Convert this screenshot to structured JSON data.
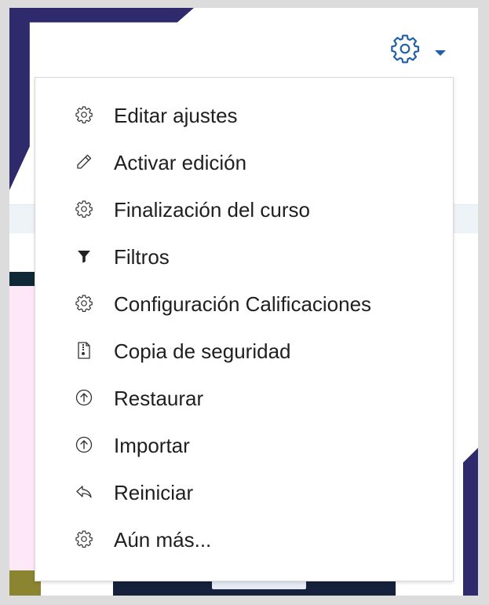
{
  "colors": {
    "accent": "#1f5fae",
    "brand_dark": "#2e2a6b",
    "text": "#1f1f1f"
  },
  "header": {
    "settings_menu_icon": "gear-icon",
    "settings_menu_caret": "caret-down-icon"
  },
  "menu": {
    "items": [
      {
        "label": "Editar ajustes",
        "icon": "gear-icon"
      },
      {
        "label": "Activar edición",
        "icon": "pencil-icon"
      },
      {
        "label": "Finalización del curso",
        "icon": "gear-icon"
      },
      {
        "label": "Filtros",
        "icon": "filter-icon"
      },
      {
        "label": "Configuración Calificaciones",
        "icon": "gear-icon"
      },
      {
        "label": "Copia de seguridad",
        "icon": "file-archive-icon"
      },
      {
        "label": "Restaurar",
        "icon": "upload-circle-icon"
      },
      {
        "label": "Importar",
        "icon": "upload-circle-icon"
      },
      {
        "label": "Reiniciar",
        "icon": "reply-icon"
      },
      {
        "label": "Aún más...",
        "icon": "gear-icon"
      }
    ]
  }
}
